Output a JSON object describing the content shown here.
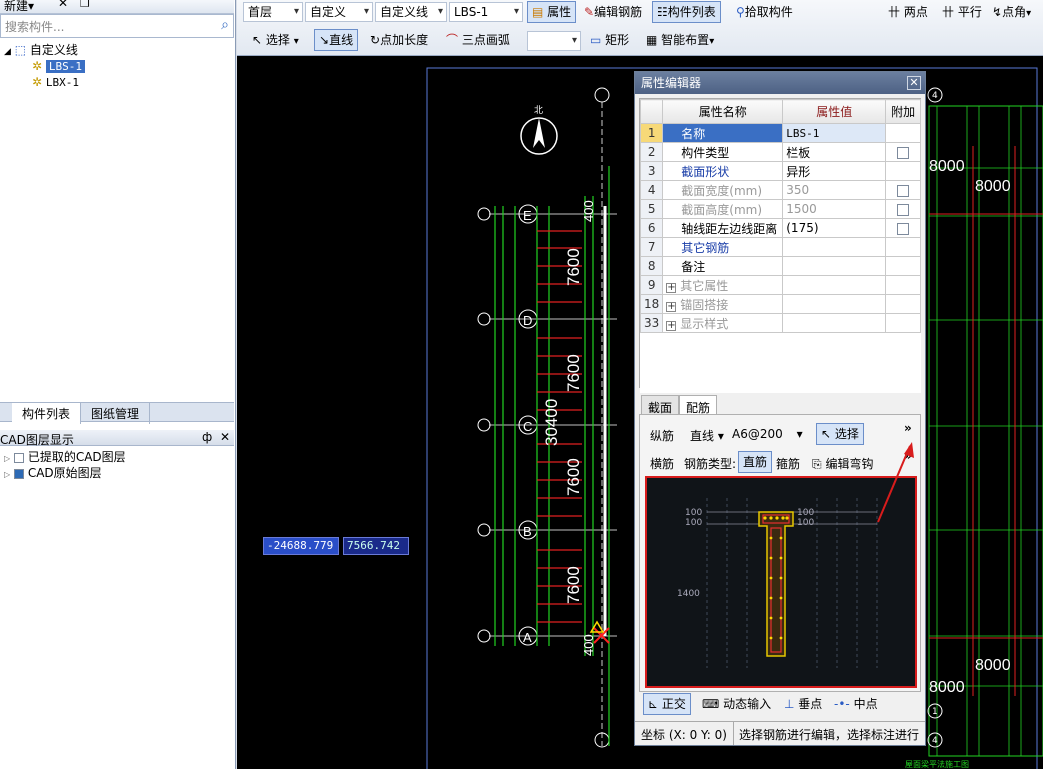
{
  "left_panel": {
    "toolbar": {
      "new_label": "新建",
      "new_dropdown": "▾"
    },
    "search_placeholder": "搜索构件...",
    "tree": {
      "root": "自定义线",
      "items": [
        {
          "label": "LBS-1",
          "selected": true
        },
        {
          "label": "LBX-1",
          "selected": false
        }
      ]
    },
    "tabs": [
      "构件列表",
      "图纸管理"
    ],
    "cad_layer": {
      "title": "CAD图层显示",
      "pin": "ф",
      "close": "✕",
      "items": [
        "已提取的CAD图层",
        "CAD原始图层"
      ]
    }
  },
  "toolbar": {
    "row1": {
      "floor": "首层",
      "category": "自定义",
      "type": "自定义线",
      "component": "LBS-1",
      "property": "属性",
      "edit_rebar": "编辑钢筋",
      "component_list": "构件列表",
      "pick_component": "拾取构件",
      "two_points": "两点",
      "parallel": "平行",
      "point_angle": "点角"
    },
    "row2": {
      "select": "选择",
      "line": "直线",
      "point_length": "点加长度",
      "three_point_arc": "三点画弧",
      "rectangle": "矩形",
      "smart_layout": "智能布置"
    }
  },
  "canvas": {
    "coord_x": "-24688.779",
    "coord_y": "7566.742",
    "axis_labels_left": [
      "E",
      "D",
      "C",
      "B",
      "A"
    ],
    "dims_vertical": [
      "7600",
      "7600",
      "30400",
      "7600",
      "7600"
    ],
    "dims_top_bottom": [
      "400",
      "400"
    ],
    "dims_right": [
      "8000",
      "8000",
      "8000",
      "8000"
    ],
    "axis_numbers": [
      "4",
      "1",
      "4"
    ],
    "compass": "北",
    "footer_text": "屋面梁平法施工图"
  },
  "property_editor": {
    "title": "属性编辑器",
    "columns": [
      "属性名称",
      "属性值",
      "附加"
    ],
    "rows": [
      {
        "idx": "1",
        "name": "名称",
        "value": "LBS-1",
        "style": "blue",
        "check": false,
        "current": true
      },
      {
        "idx": "2",
        "name": "构件类型",
        "value": "栏板",
        "style": "normal",
        "check": true
      },
      {
        "idx": "3",
        "name": "截面形状",
        "value": "异形",
        "style": "blue",
        "check": false
      },
      {
        "idx": "4",
        "name": "截面宽度(mm)",
        "value": "350",
        "style": "gray",
        "check": true
      },
      {
        "idx": "5",
        "name": "截面高度(mm)",
        "value": "1500",
        "style": "gray",
        "check": true
      },
      {
        "idx": "6",
        "name": "轴线距左边线距离",
        "value": "(175)",
        "style": "normal",
        "check": true
      },
      {
        "idx": "7",
        "name": "其它钢筋",
        "value": "",
        "style": "blue",
        "check": false
      },
      {
        "idx": "8",
        "name": "备注",
        "value": "",
        "style": "normal",
        "check": false
      },
      {
        "idx": "9",
        "name": "其它属性",
        "value": "",
        "style": "gray",
        "group": true
      },
      {
        "idx": "18",
        "name": "锚固搭接",
        "value": "",
        "style": "gray",
        "group": true
      },
      {
        "idx": "33",
        "name": "显示样式",
        "value": "",
        "style": "gray",
        "group": true
      }
    ],
    "section_tabs": [
      "截面",
      "配筋"
    ],
    "rebar_row1": {
      "label": "纵筋",
      "line_mode": "直线",
      "spec": "A6@200",
      "select": "选择",
      "more": "»"
    },
    "rebar_row2": {
      "label": "横筋",
      "rebar_type": "钢筋类型:",
      "straight": "直筋",
      "stirrup": "箍筋",
      "edit_hook": "编辑弯钩",
      "more": "»"
    },
    "preview_labels": [
      "100",
      "100",
      "1400",
      "100",
      "100"
    ],
    "snap": {
      "ortho": "正交",
      "dynamic_input": "动态输入",
      "perpendicular": "垂点",
      "midpoint": "中点"
    },
    "status": {
      "coords": "坐标 (X: 0 Y: 0)",
      "hint": "选择钢筋进行编辑，选择标注进行"
    }
  }
}
